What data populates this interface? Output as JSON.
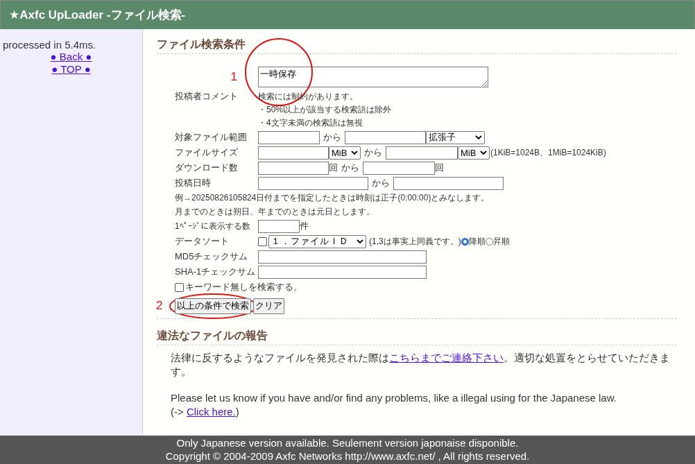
{
  "header": {
    "title": "★Axfc UpLoader -ファイル検索-"
  },
  "sidebar": {
    "status": "processed in 5.4ms.",
    "links": [
      "● Back ●",
      "● TOP ●"
    ]
  },
  "search_section": {
    "heading": "ファイル検索条件",
    "keyword": {
      "annotation": "1",
      "value": "一時保存"
    },
    "comment": {
      "label": "投稿者コメント",
      "notes": [
        "検索には制約があります。",
        "・50%以上が該当する検索語は除外",
        "・4文字未満の検索語は無視"
      ]
    },
    "file_range": {
      "label": "対象ファイル範囲",
      "from_word": "から",
      "extension": "拡張子"
    },
    "file_size": {
      "label": "ファイルサイズ",
      "unit_1": "MiB",
      "from_word": "から",
      "unit_2": "MiB",
      "note": "(1KiB=1024B、1MiB=1024KiB)"
    },
    "download_count": {
      "label": "ダウンロード数",
      "unit_1": "回",
      "from_word": "から",
      "unit_2": "回"
    },
    "post_date": {
      "label": "投稿日時",
      "from_word": "から"
    },
    "date_notes": [
      "例→20250826105824日付までを指定したときは時刻は正子(0:00:00)とみなします。",
      "月までのときは朔日、年までのときは元日とします。"
    ],
    "per_page": {
      "label": "1ﾍﾟｰｼﾞに表示する数",
      "unit": "件"
    },
    "sort": {
      "label": "データソート",
      "checked": false,
      "field": "１．ファイルＩＤ",
      "note": "(1,3は事実上同義です。)",
      "orders": [
        {
          "label": "降順",
          "selected": true
        },
        {
          "label": "昇順",
          "selected": false
        }
      ]
    },
    "md5": {
      "label": "MD5チェックサム"
    },
    "sha1": {
      "label": "SHA-1チェックサム"
    },
    "no_keyword": {
      "label": "キーワード無しを検索する。",
      "checked": false
    },
    "buttons_annotation": "2",
    "buttons": [
      "以上の条件で検索",
      "クリア"
    ]
  },
  "report_section": {
    "heading": "違法なファイルの報告",
    "japanese": {
      "before": "法律に反するようなファイルを発見された際は",
      "link": "こちらまでご連絡下さい",
      "after": "。適切な処置をとらせていただきます。"
    },
    "english": {
      "text": "Please let us know if you have and/or find any problems, like a illegal using for the Japanese law.",
      "before": "(->",
      "link": "Click here.",
      "after": ")"
    }
  },
  "footer": [
    "Only Japanese version available. Seulement version japonaise disponible.",
    "Copyright © 2004-2009 Axfc Networks http://www.axfc.net/ , All rights reserved."
  ]
}
